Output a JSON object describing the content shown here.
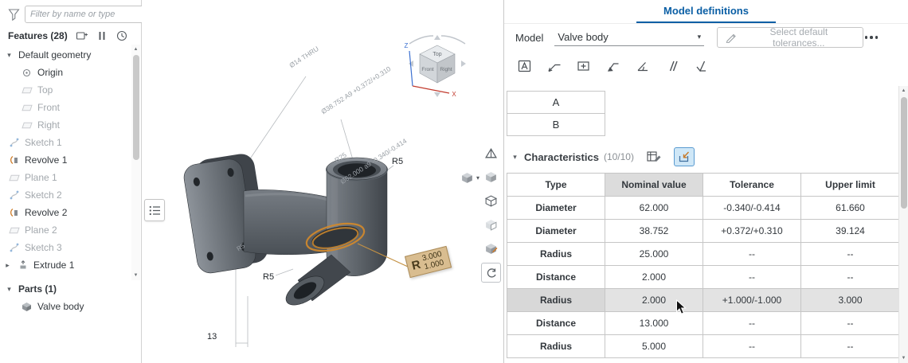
{
  "colors": {
    "accent_blue": "#0b5fa5",
    "selection_orange": "#d1892b",
    "callout_bg": "#d9bd90",
    "active_tool_bg": "#cfe7f7",
    "highlight_row": "#e3e3e3"
  },
  "left_panel": {
    "filter_placeholder": "Filter by name or type",
    "features_label": "Features (28)",
    "tree": [
      {
        "label": "Default geometry",
        "icon": "chevron-down-icon"
      },
      {
        "label": "Origin",
        "icon": "origin-icon"
      },
      {
        "label": "Top",
        "icon": "plane-icon",
        "muted": true
      },
      {
        "label": "Front",
        "icon": "plane-icon",
        "muted": true
      },
      {
        "label": "Right",
        "icon": "plane-icon",
        "muted": true
      },
      {
        "label": "Sketch 1",
        "icon": "sketch-icon",
        "muted": true
      },
      {
        "label": "Revolve 1",
        "icon": "revolve-icon"
      },
      {
        "label": "Plane 1",
        "icon": "plane-icon",
        "muted": true
      },
      {
        "label": "Sketch 2",
        "icon": "sketch-icon",
        "muted": true
      },
      {
        "label": "Revolve 2",
        "icon": "revolve-icon"
      },
      {
        "label": "Plane 2",
        "icon": "plane-icon",
        "muted": true
      },
      {
        "label": "Sketch 3",
        "icon": "sketch-icon",
        "muted": true
      },
      {
        "label": "Extrude 1",
        "icon": "extrude-icon",
        "expandable": true
      }
    ],
    "parts_label": "Parts (1)",
    "parts": [
      {
        "label": "Valve body",
        "icon": "part-icon"
      }
    ]
  },
  "viewport": {
    "annotations": {
      "dia14": "Ø14 THRU",
      "dia38": "Ø38.752 A9 +0.372/+0.310",
      "r25": "R25",
      "r5_top": "R5",
      "dia62": "Ø62.000 a9 -0.340/-0.414",
      "r5_small": "R5",
      "r5_bottom": "R5",
      "dim13": "13"
    },
    "callout": {
      "prefix": "R",
      "upper": "3.000",
      "lower": "1.000"
    },
    "viewcube": {
      "top": "Top",
      "front": "Front",
      "right": "Right",
      "z_axis": "Z",
      "x_axis": "X"
    }
  },
  "right_panel": {
    "title": "Model definitions",
    "model_label": "Model",
    "model_value": "Valve body",
    "tolerance_button_label": "Select default tolerances...",
    "datums": {
      "a": "A",
      "b": "B"
    },
    "characteristics_label": "Characteristics",
    "characteristics_count": "(10/10)",
    "table": {
      "headers": [
        "Type",
        "Nominal value",
        "Tolerance",
        "Upper limit"
      ],
      "rows": [
        [
          "Diameter",
          "62.000",
          "-0.340/-0.414",
          "61.660"
        ],
        [
          "Diameter",
          "38.752",
          "+0.372/+0.310",
          "39.124"
        ],
        [
          "Radius",
          "25.000",
          "--",
          "--"
        ],
        [
          "Distance",
          "2.000",
          "--",
          "--"
        ],
        [
          "Radius",
          "2.000",
          "+1.000/-1.000",
          "3.000"
        ],
        [
          "Distance",
          "13.000",
          "--",
          "--"
        ],
        [
          "Radius",
          "5.000",
          "--",
          "--"
        ]
      ],
      "highlighted_row_index": 4
    }
  }
}
